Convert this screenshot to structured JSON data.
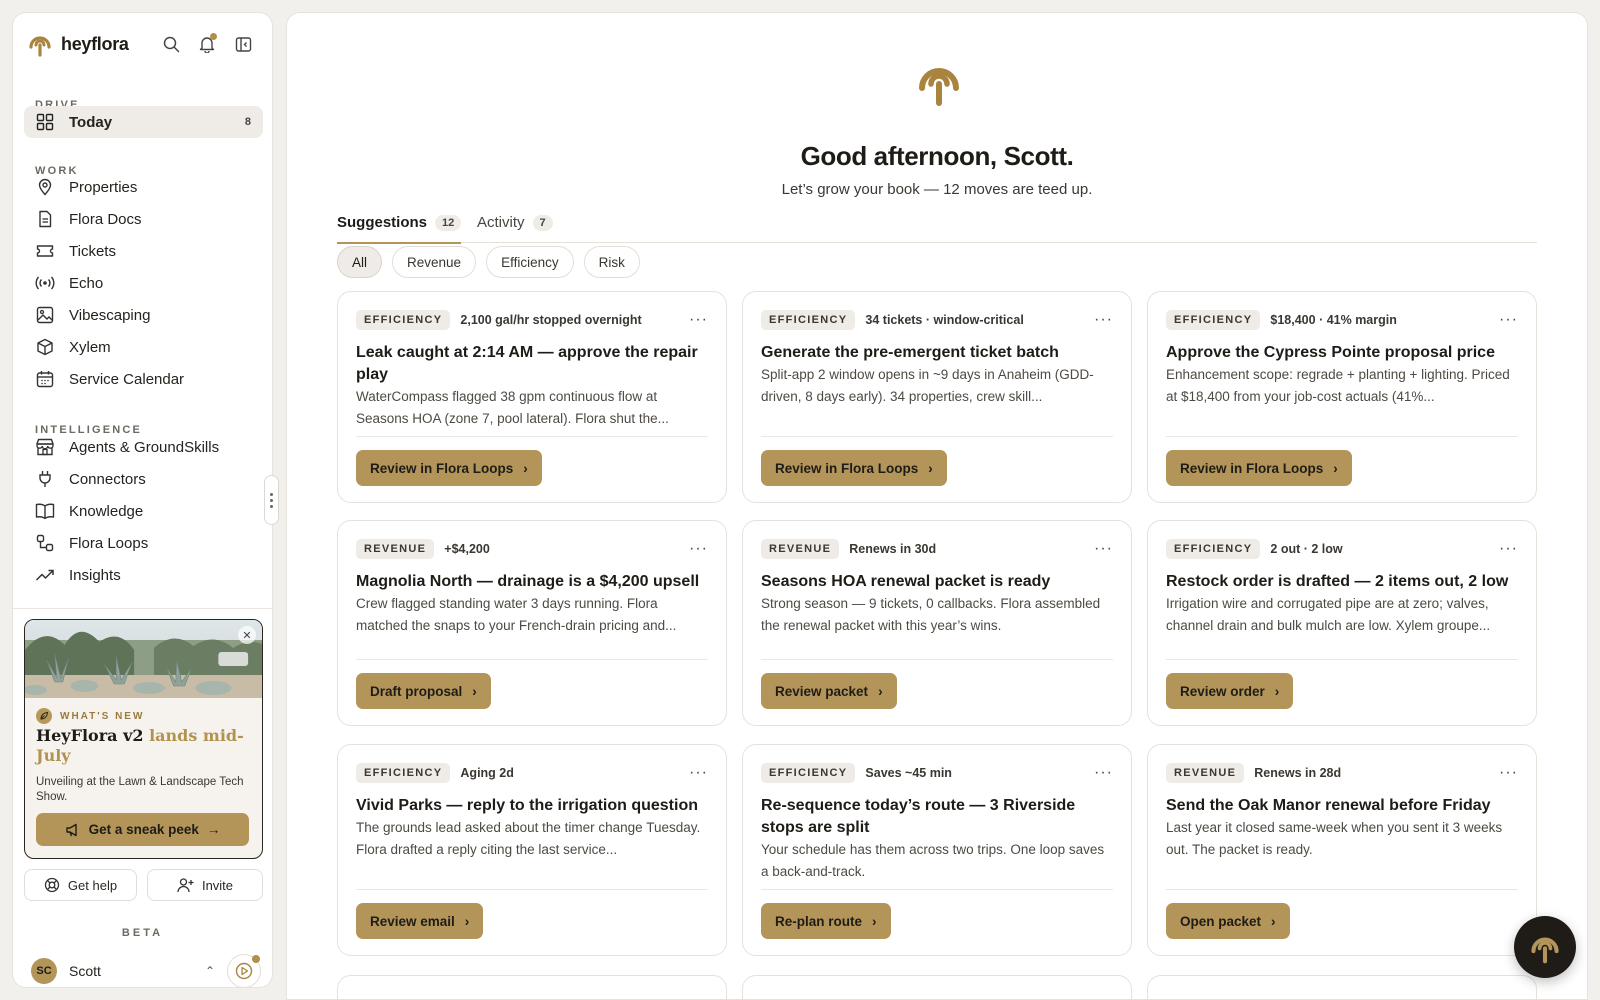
{
  "brand": {
    "name": "heyflora"
  },
  "sidebar": {
    "sections": {
      "drive": "DRIVE",
      "work": "WORK",
      "intelligence": "INTELLIGENCE"
    },
    "today": {
      "label": "Today",
      "badge": "8"
    },
    "work_items": [
      {
        "label": "Properties",
        "icon": "map-pin-icon"
      },
      {
        "label": "Flora Docs",
        "icon": "document-icon"
      },
      {
        "label": "Tickets",
        "icon": "ticket-icon"
      },
      {
        "label": "Echo",
        "icon": "broadcast-icon"
      },
      {
        "label": "Vibescaping",
        "icon": "image-icon"
      },
      {
        "label": "Xylem",
        "icon": "box-icon"
      },
      {
        "label": "Service Calendar",
        "icon": "calendar-icon"
      }
    ],
    "intelligence_items": [
      {
        "label": "Agents & GroundSkills",
        "icon": "storefront-icon"
      },
      {
        "label": "Connectors",
        "icon": "plug-icon"
      },
      {
        "label": "Knowledge",
        "icon": "book-icon"
      },
      {
        "label": "Flora Loops",
        "icon": "workflow-icon"
      },
      {
        "label": "Insights",
        "icon": "trend-icon"
      }
    ],
    "promo": {
      "tag": "WHAT'S NEW",
      "title_main": "HeyFlora v2 ",
      "title_accent": "lands mid-July",
      "description": "Unveiling at the Lawn & Landscape Tech Show.",
      "button": "Get a sneak peek"
    },
    "help_label": "Get help",
    "invite_label": "Invite",
    "beta_label": "BETA",
    "user": {
      "initials": "SC",
      "name": "Scott"
    }
  },
  "main": {
    "greeting": "Good afternoon, Scott.",
    "subgreeting": "Let’s grow your book — 12 moves are teed up.",
    "tabs": [
      {
        "label": "Suggestions",
        "count": "12"
      },
      {
        "label": "Activity",
        "count": "7"
      }
    ],
    "filters": [
      "All",
      "Revenue",
      "Efficiency",
      "Risk"
    ],
    "cards": [
      {
        "tag": "EFFICIENCY",
        "meta": "2,100 gal/hr stopped overnight",
        "title": "Leak caught at 2:14 AM — approve the repair play",
        "desc": "WaterCompass flagged 38 gpm continuous flow at Seasons HOA (zone 7, pool lateral). Flora shut the...",
        "button": "Review in Flora Loops"
      },
      {
        "tag": "EFFICIENCY",
        "meta": "34 tickets · window-critical",
        "title": "Generate the pre-emergent ticket batch",
        "desc": "Split-app 2 window opens in ~9 days in Anaheim (GDD-driven, 8 days early). 34 properties, crew skill...",
        "button": "Review in Flora Loops"
      },
      {
        "tag": "EFFICIENCY",
        "meta": "$18,400 · 41% margin",
        "title": "Approve the Cypress Pointe proposal price",
        "desc": "Enhancement scope: regrade + planting + lighting. Priced at $18,400 from your job-cost actuals (41%...",
        "button": "Review in Flora Loops"
      },
      {
        "tag": "REVENUE",
        "meta": "+$4,200",
        "title": "Magnolia North — drainage is a $4,200 upsell",
        "desc": "Crew flagged standing water 3 days running. Flora matched the snaps to your French-drain pricing and...",
        "button": "Draft proposal"
      },
      {
        "tag": "REVENUE",
        "meta": "Renews in 30d",
        "title": "Seasons HOA renewal packet is ready",
        "desc": "Strong season — 9 tickets, 0 callbacks. Flora assembled the renewal packet with this year’s wins.",
        "button": "Review packet"
      },
      {
        "tag": "EFFICIENCY",
        "meta": "2 out · 2 low",
        "title": "Restock order is drafted — 2 items out, 2 low",
        "desc": "Irrigation wire and corrugated pipe are at zero; valves, channel drain and bulk mulch are low. Xylem groupe...",
        "button": "Review order"
      },
      {
        "tag": "EFFICIENCY",
        "meta": "Aging 2d",
        "title": "Vivid Parks — reply to the irrigation question",
        "desc": "The grounds lead asked about the timer change Tuesday. Flora drafted a reply citing the last service...",
        "button": "Review email"
      },
      {
        "tag": "EFFICIENCY",
        "meta": "Saves ~45 min",
        "title": "Re-sequence today’s route — 3 Riverside stops are split",
        "desc": "Your schedule has them across two trips. One loop saves a back-and-track.",
        "button": "Re-plan route"
      },
      {
        "tag": "REVENUE",
        "meta": "Renews in 28d",
        "title": "Send the Oak Manor renewal before Friday",
        "desc": "Last year it closed same-week when you sent it 3 weeks out. The packet is ready.",
        "button": "Open packet"
      }
    ]
  }
}
